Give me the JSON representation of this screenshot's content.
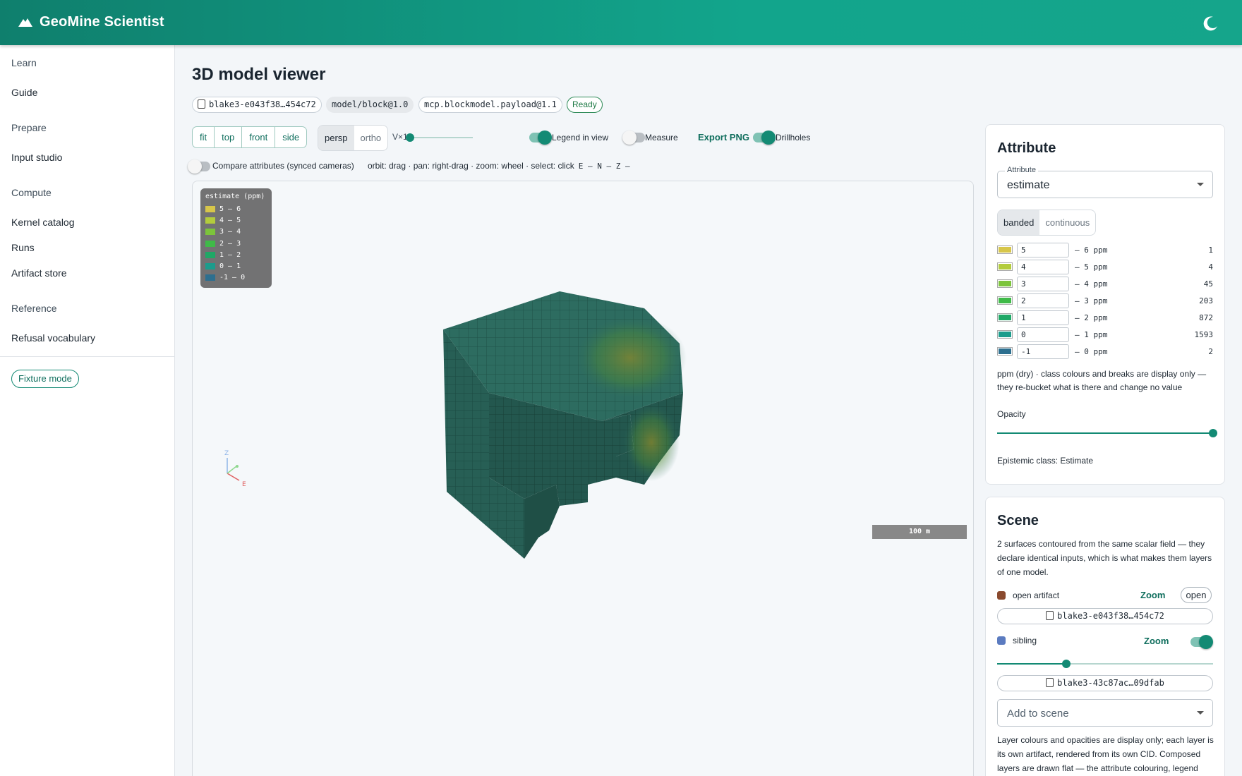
{
  "app": {
    "title": "GeoMine Scientist"
  },
  "sidebar": {
    "groups": [
      {
        "label": "Learn",
        "items": [
          "Guide"
        ]
      },
      {
        "label": "Prepare",
        "items": [
          "Input studio"
        ]
      },
      {
        "label": "Compute",
        "items": [
          "Kernel catalog",
          "Runs",
          "Artifact store"
        ]
      },
      {
        "label": "Reference",
        "items": [
          "Refusal vocabulary"
        ]
      }
    ],
    "fixture_mode": "Fixture mode"
  },
  "page": {
    "title": "3D model viewer",
    "cid": "blake3-e043f38…454c72",
    "schema": "model/block@1.0",
    "payload": "mcp.blockmodel.payload@1.1",
    "status": "Ready"
  },
  "toolbar": {
    "views": [
      "fit",
      "top",
      "front",
      "side"
    ],
    "projection": [
      "persp",
      "ortho"
    ],
    "projection_active": "persp",
    "vx_label": "V×1",
    "vx_value": 0.1,
    "legend_in_view": {
      "label": "Legend in view",
      "on": true
    },
    "measure": {
      "label": "Measure",
      "on": false
    },
    "export": "Export PNG",
    "drillholes": {
      "label": "Drillholes",
      "on": true
    },
    "compare": {
      "label": "Compare attributes (synced cameras)",
      "on": false
    },
    "hint": "orbit: drag · pan: right-drag · zoom: wheel · select: click",
    "axes_hint": "E — N — Z —"
  },
  "viewport": {
    "legend_title": "estimate (ppm)",
    "legend": [
      {
        "label": "5 – 6",
        "color": "#d7c64a"
      },
      {
        "label": "4 – 5",
        "color": "#b3cc3c"
      },
      {
        "label": "3 – 4",
        "color": "#7cc43b"
      },
      {
        "label": "2 – 3",
        "color": "#3fba48"
      },
      {
        "label": "1 – 2",
        "color": "#1fa866"
      },
      {
        "label": "0 – 1",
        "color": "#1c9c8c"
      },
      {
        "label": "-1 – 0",
        "color": "#2d6f8f"
      }
    ],
    "scale_bar": "100 m",
    "axis_z": "Z",
    "axis_e": "E",
    "block_color": "#2b6a5e"
  },
  "attribute_panel": {
    "title": "Attribute",
    "select_label": "Attribute",
    "select_value": "estimate",
    "modes": [
      "banded",
      "continuous"
    ],
    "mode_active": "banded",
    "bands": [
      {
        "lower": "5",
        "upper": "– 6 ppm",
        "count": "1",
        "color": "#d7c64a"
      },
      {
        "lower": "4",
        "upper": "– 5 ppm",
        "count": "4",
        "color": "#b3cc3c"
      },
      {
        "lower": "3",
        "upper": "– 4 ppm",
        "count": "45",
        "color": "#7cc43b"
      },
      {
        "lower": "2",
        "upper": "– 3 ppm",
        "count": "203",
        "color": "#3fba48"
      },
      {
        "lower": "1",
        "upper": "– 2 ppm",
        "count": "872",
        "color": "#1fa866"
      },
      {
        "lower": "0",
        "upper": "– 1 ppm",
        "count": "1593",
        "color": "#1c9c8c"
      },
      {
        "lower": "-1",
        "upper": "– 0 ppm",
        "count": "2",
        "color": "#2d6f8f"
      }
    ],
    "note": "ppm (dry) · class colours and breaks are display only — they re-bucket what is there and change no value",
    "opacity_label": "Opacity",
    "opacity_value": 1.0,
    "epistemic": "Epistemic class: Estimate"
  },
  "scene_panel": {
    "title": "Scene",
    "description": "2 surfaces contoured from the same scalar field — they declare identical inputs, which is what makes them layers of one model.",
    "layers": [
      {
        "name": "open artifact",
        "color": "#8a4a2e",
        "zoom": "Zoom",
        "action": "open",
        "cid": "blake3-e043f38…454c72"
      },
      {
        "name": "sibling",
        "color": "#5b7bc0",
        "zoom": "Zoom",
        "on": true,
        "opacity": 0.32,
        "cid": "blake3-43c87ac…09dfab"
      }
    ],
    "add_placeholder": "Add to scene",
    "footnote": "Layer colours and opacities are display only; each layer is its own artifact, rendered from its own CID. Composed layers are drawn flat — the attribute colouring, legend"
  }
}
